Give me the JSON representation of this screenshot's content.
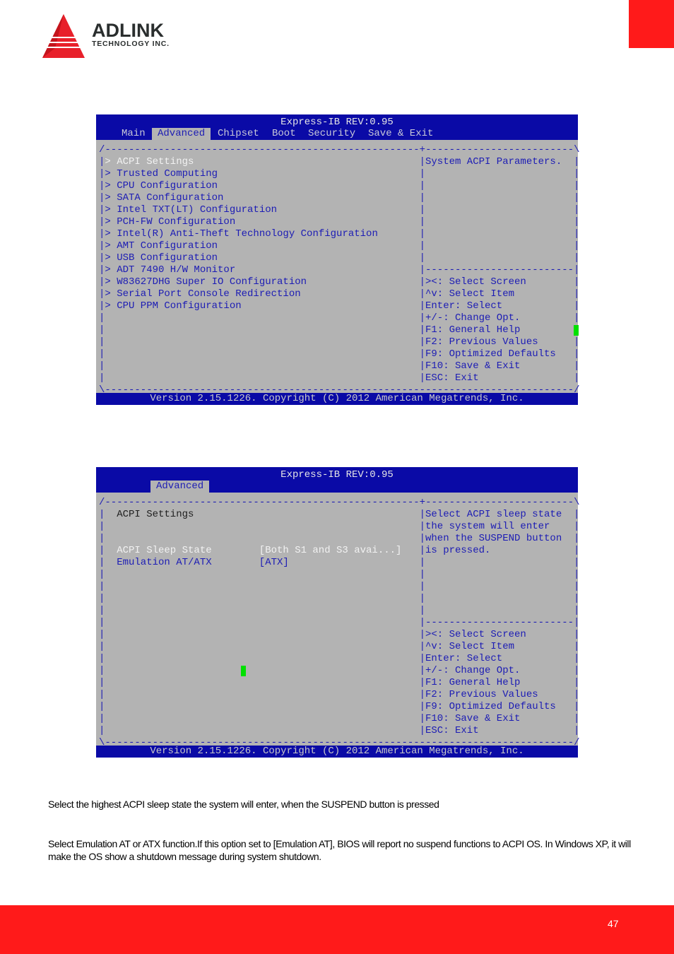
{
  "header": {
    "logo_text": "ADLINK",
    "logo_subtext": "TECHNOLOGY INC.",
    "brand_color": "#ff1a1a"
  },
  "screens": [
    {
      "title": "Express-IB REV:0.95",
      "tabs": [
        "Main",
        "Advanced",
        "Chipset",
        "Boot",
        "Security",
        "Save & Exit"
      ],
      "active_tab": "Advanced",
      "left_rows": [
        {
          "text": "> ACPI Settings",
          "highlight": true
        },
        {
          "text": "> Trusted Computing"
        },
        {
          "text": "> CPU Configuration"
        },
        {
          "text": "> SATA Configuration"
        },
        {
          "text": "> Intel TXT(LT) Configuration"
        },
        {
          "text": "> PCH-FW Configuration"
        },
        {
          "text": "> Intel(R) Anti-Theft Technology Configuration"
        },
        {
          "text": "> AMT Configuration"
        },
        {
          "text": "> USB Configuration"
        },
        {
          "text": "> ADT 7490 H/W Monitor"
        },
        {
          "text": "> W83627DHG Super IO Configuration"
        },
        {
          "text": "> Serial Port Console Redirection"
        },
        {
          "text": "> CPU PPM Configuration"
        }
      ],
      "help_lines": [
        "System ACPI Parameters."
      ],
      "keys": [
        "><: Select Screen",
        "^v: Select Item",
        "Enter: Select",
        "+/-: Change Opt.",
        "F1: General Help",
        "F2: Previous Values",
        "F9: Optimized Defaults",
        "F10: Save & Exit",
        "ESC: Exit"
      ],
      "footer": "Version 2.15.1226. Copyright (C) 2012 American Megatrends, Inc."
    },
    {
      "title": "Express-IB REV:0.95",
      "tabs": [
        "Advanced"
      ],
      "active_tab": "Advanced",
      "left_rows": [
        {
          "text": "  ACPI Settings",
          "dark": true
        },
        {
          "text": ""
        },
        {
          "text": ""
        },
        {
          "text": "  ACPI Sleep State",
          "value": "[Both S1 and S3 avai...]",
          "highlight": true
        },
        {
          "text": "  Emulation AT/ATX",
          "value": "[ATX]"
        }
      ],
      "help_lines": [
        "Select ACPI sleep state",
        "the system will enter",
        "when the SUSPEND button",
        "is pressed."
      ],
      "keys": [
        "><: Select Screen",
        "^v: Select Item",
        "Enter: Select",
        "+/-: Change Opt.",
        "F1: General Help",
        "F2: Previous Values",
        "F9: Optimized Defaults",
        "F10: Save & Exit",
        "ESC: Exit"
      ],
      "footer": "Version 2.15.1226. Copyright (C) 2012 American Megatrends, Inc."
    }
  ],
  "descriptions": [
    "Select the highest ACPI sleep state the system will enter, when the SUSPEND button is pressed",
    "Select Emulation AT or ATX function.If this option set to [Emulation AT], BIOS will report no suspend functions to ACPI OS. In Windows XP, it will make the OS show a shutdown message during system shutdown."
  ],
  "page_number": "47"
}
